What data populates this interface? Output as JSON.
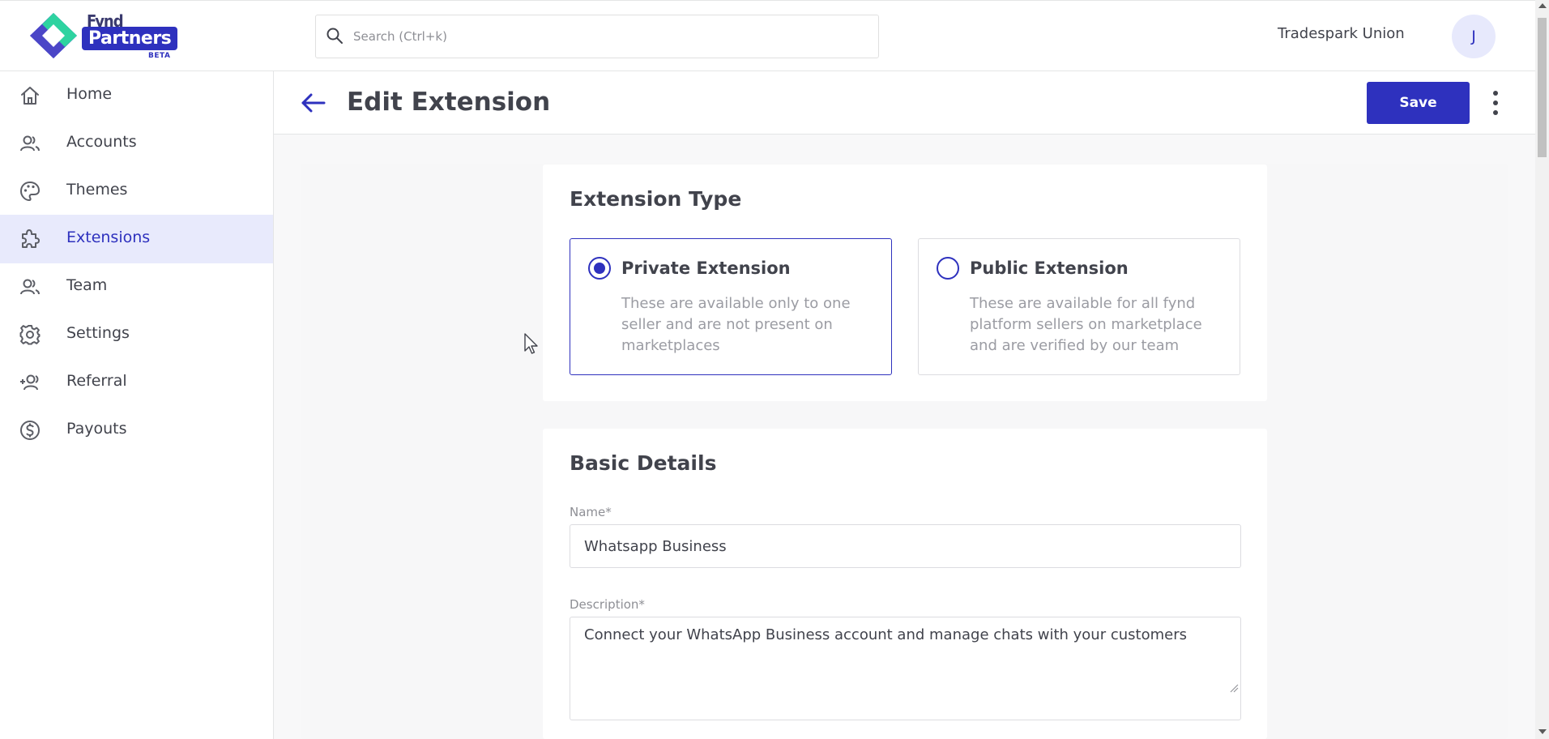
{
  "brand": {
    "logo_top": "Fynd",
    "logo_main": "Partners",
    "logo_badge": "BETA",
    "colors": {
      "primary": "#2e31be",
      "active_bg": "#e8eafc",
      "logo_green": "#2ed3a0",
      "logo_blue": "#3b3fd8"
    }
  },
  "header": {
    "search_placeholder": "Search (Ctrl+k)",
    "search_icon": "search-icon",
    "org_name": "Tradespark Union",
    "avatar_initial": "J"
  },
  "sidebar": {
    "items": [
      {
        "label": "Home",
        "icon": "home-icon",
        "active": false
      },
      {
        "label": "Accounts",
        "icon": "users-icon",
        "active": false
      },
      {
        "label": "Themes",
        "icon": "palette-icon",
        "active": false
      },
      {
        "label": "Extensions",
        "icon": "puzzle-icon",
        "active": true
      },
      {
        "label": "Team",
        "icon": "team-icon",
        "active": false
      },
      {
        "label": "Settings",
        "icon": "gear-icon",
        "active": false
      },
      {
        "label": "Referral",
        "icon": "user-plus-icon",
        "active": false
      },
      {
        "label": "Payouts",
        "icon": "dollar-circle-icon",
        "active": false
      }
    ]
  },
  "page": {
    "title": "Edit Extension",
    "save_label": "Save",
    "back_icon": "arrow-left-icon",
    "more_icon": "more-vertical-icon"
  },
  "extension_type": {
    "title": "Extension Type",
    "options": [
      {
        "title": "Private Extension",
        "description": "These are available only to one seller and are not present on marketplaces",
        "selected": true
      },
      {
        "title": "Public Extension",
        "description": "These are available for all fynd platform sellers on marketplace and are verified by our team",
        "selected": false
      }
    ]
  },
  "basic_details": {
    "title": "Basic Details",
    "name_label": "Name*",
    "name_value": "Whatsapp Business",
    "description_label": "Description*",
    "description_value": "Connect your WhatsApp Business account and manage chats with your customers"
  }
}
